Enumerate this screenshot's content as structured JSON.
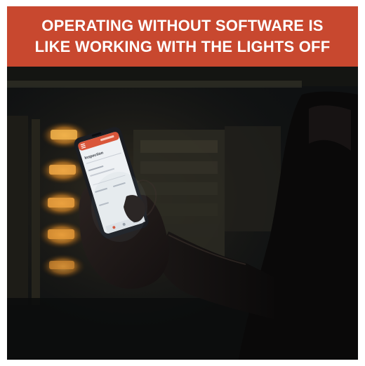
{
  "banner": {
    "line1": "OPERATING WITHOUT SOFTWARE IS",
    "line2": "LIKE WORKING WITH THE LIGHTS OFF",
    "background": "#c8482f",
    "text_color": "#ffffff"
  },
  "photo": {
    "phone_screen_title": "Inspection",
    "icons": [
      "hamburger-menu-icon"
    ],
    "colors": {
      "background": "#0f1112",
      "warm_light": "#e8a23a",
      "phone_header": "#d9563a",
      "phone_screen": "#eef1f4"
    }
  }
}
